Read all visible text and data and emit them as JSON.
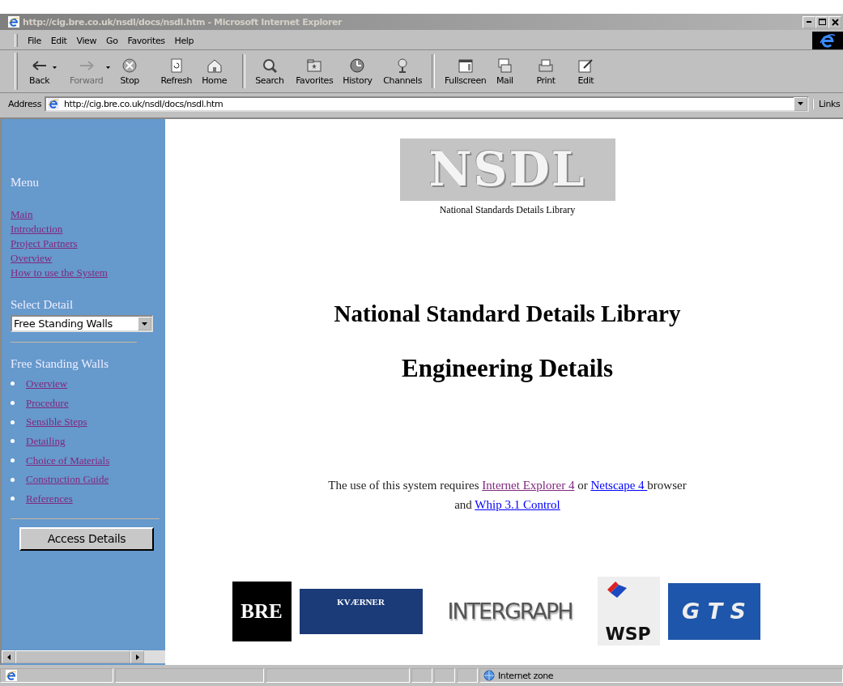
{
  "window": {
    "title": "http://cig.bre.co.uk/nsdl/docs/nsdl.htm - Microsoft Internet Explorer",
    "active": false
  },
  "menu_bar": [
    "File",
    "Edit",
    "View",
    "Go",
    "Favorites",
    "Help"
  ],
  "toolbar": [
    {
      "label": "Back",
      "kind": "back",
      "disabled": false,
      "dropdown": true
    },
    {
      "label": "Forward",
      "kind": "forward",
      "disabled": true,
      "dropdown": true
    },
    {
      "label": "Stop",
      "kind": "stop",
      "disabled": false,
      "dropdown": false
    },
    {
      "label": "Refresh",
      "kind": "refresh",
      "disabled": false,
      "dropdown": false
    },
    {
      "label": "Home",
      "kind": "home",
      "disabled": false,
      "dropdown": false
    },
    {
      "label": "Search",
      "kind": "search",
      "disabled": false,
      "dropdown": false
    },
    {
      "label": "Favorites",
      "kind": "favorites",
      "disabled": false,
      "dropdown": false
    },
    {
      "label": "History",
      "kind": "history",
      "disabled": false,
      "dropdown": false
    },
    {
      "label": "Channels",
      "kind": "channels",
      "disabled": false,
      "dropdown": false
    },
    {
      "label": "Fullscreen",
      "kind": "fullscreen",
      "disabled": false,
      "dropdown": false
    },
    {
      "label": "Mail",
      "kind": "mail",
      "disabled": false,
      "dropdown": false
    },
    {
      "label": "Print",
      "kind": "print",
      "disabled": false,
      "dropdown": false
    },
    {
      "label": "Edit",
      "kind": "edit",
      "disabled": false,
      "dropdown": false
    }
  ],
  "address_bar": {
    "label": "Address",
    "value": "http://cig.bre.co.uk/nsdl/docs/nsdl.htm",
    "links_label": "Links"
  },
  "sidebar": {
    "menu_title": "Menu",
    "menu_links": [
      {
        "text": "Main",
        "visited": true
      },
      {
        "text": "Introduction",
        "visited": true
      },
      {
        "text": "Project Partners",
        "visited": true
      },
      {
        "text": "Overview",
        "visited": true
      },
      {
        "text": "How to use the System",
        "visited": true
      }
    ],
    "select_label": "Select Detail",
    "select_value": "Free Standing Walls",
    "section_title": "Free Standing Walls",
    "section_links": [
      {
        "text": "Overview",
        "visited": true
      },
      {
        "text": "Procedure",
        "visited": true
      },
      {
        "text": "Sensible Steps",
        "visited": true
      },
      {
        "text": "Detailing",
        "visited": true
      },
      {
        "text": "Choice of Materials",
        "visited": true
      },
      {
        "text": "Construction Guide",
        "visited": true
      },
      {
        "text": "References",
        "visited": true
      }
    ],
    "button": "Access Details"
  },
  "main": {
    "logo": "NSDL",
    "logo_caption": "National Standards Details Library",
    "heading": "National Standard Details Library",
    "subheading": "Engineering Details",
    "requirements": [
      {
        "kind": "text",
        "text": "The use of this system requires "
      },
      {
        "kind": "link",
        "text": "Internet Explorer 4",
        "visited": true
      },
      {
        "kind": "text",
        "text": " or "
      },
      {
        "kind": "link",
        "text": "Netscape 4 ",
        "visited": false
      },
      {
        "kind": "text",
        "text": "browser"
      },
      {
        "kind": "break"
      },
      {
        "kind": "text",
        "text": "and "
      },
      {
        "kind": "link",
        "text": "Whip 3.1 Control",
        "visited": false
      }
    ],
    "partner_logos": [
      {
        "kind": "bre",
        "text": "BRE"
      },
      {
        "kind": "kvaerner",
        "text": "KVÆRNER"
      },
      {
        "kind": "intergraph",
        "text": "INTERGRAPH"
      },
      {
        "kind": "wsp",
        "text": "WSP"
      },
      {
        "kind": "gts",
        "text": "G T S"
      }
    ]
  },
  "status_bar": {
    "zone": "Internet zone"
  }
}
